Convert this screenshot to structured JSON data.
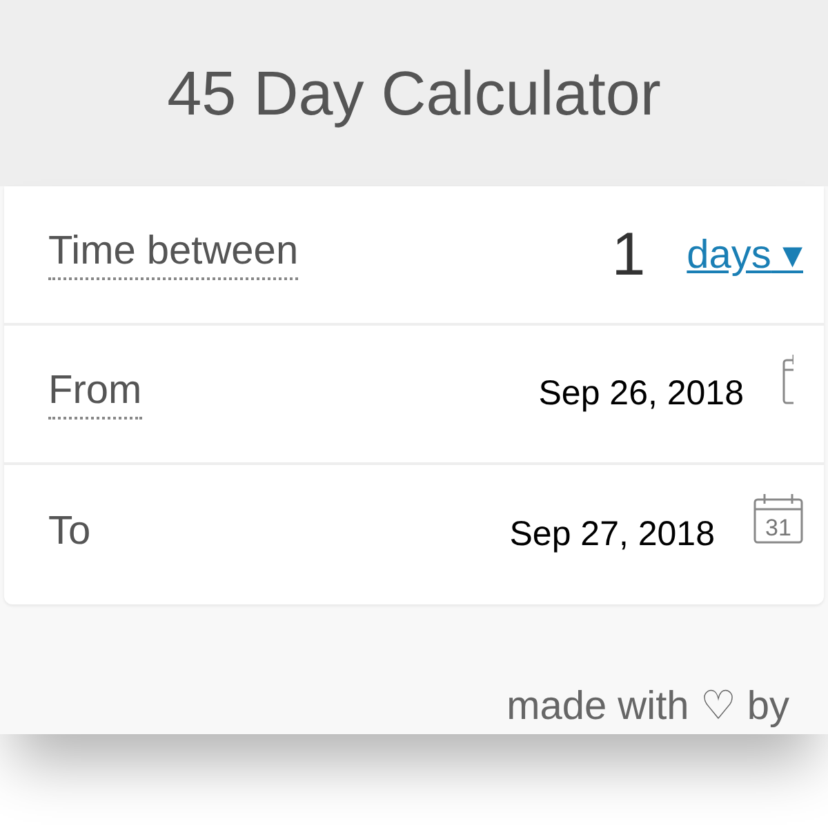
{
  "title": "45 Day Calculator",
  "rows": [
    {
      "kind": "duration",
      "label": "Time between",
      "value": "1",
      "unit": "days",
      "caret": "▾"
    },
    {
      "kind": "date",
      "label": "From",
      "value": "Sep 26, 2018",
      "icon_clipped": true
    },
    {
      "kind": "date",
      "label": "To",
      "value": "Sep 27, 2018",
      "icon_clipped": false,
      "calendar_day": "31"
    }
  ],
  "footer": "made with ♡ by"
}
